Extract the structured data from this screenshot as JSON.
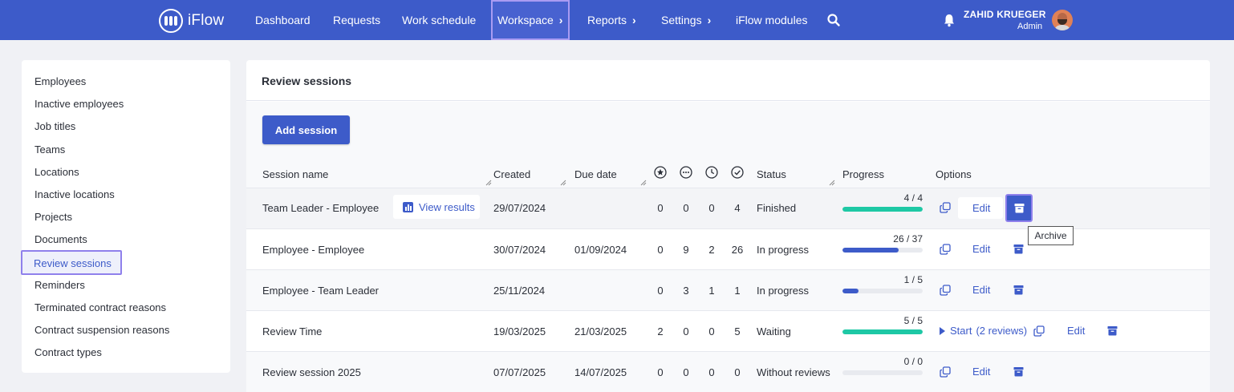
{
  "app": {
    "logo_text": "iFlow"
  },
  "nav": {
    "items": [
      {
        "label": "Dashboard",
        "chevron": false
      },
      {
        "label": "Requests",
        "chevron": false
      },
      {
        "label": "Work schedule",
        "chevron": false
      },
      {
        "label": "Workspace",
        "chevron": true,
        "active": true
      },
      {
        "label": "Reports",
        "chevron": true
      },
      {
        "label": "Settings",
        "chevron": true
      },
      {
        "label": "iFlow modules",
        "chevron": false
      }
    ],
    "chevron_glyph": "›",
    "search_icon": "search-icon"
  },
  "user": {
    "name": "ZAHID KRUEGER",
    "role": "Admin"
  },
  "sidebar": {
    "items": [
      {
        "label": "Employees"
      },
      {
        "label": "Inactive employees"
      },
      {
        "label": "Job titles"
      },
      {
        "label": "Teams"
      },
      {
        "label": "Locations"
      },
      {
        "label": "Inactive locations"
      },
      {
        "label": "Projects"
      },
      {
        "label": "Documents"
      },
      {
        "label": "Review sessions",
        "active": true
      },
      {
        "label": "Reminders"
      },
      {
        "label": "Terminated contract reasons"
      },
      {
        "label": "Contract suspension reasons"
      },
      {
        "label": "Contract types"
      }
    ]
  },
  "main": {
    "title": "Review sessions",
    "add_button": "Add session",
    "columns": {
      "name": "Session name",
      "created": "Created",
      "due": "Due date",
      "status": "Status",
      "progress": "Progress",
      "options": "Options"
    },
    "count_icons": [
      "star-icon",
      "more-icon",
      "clock-icon",
      "check-circle-icon"
    ],
    "view_results": "View results",
    "edit_label": "Edit",
    "rows": [
      {
        "name": "Team Leader - Employee",
        "created": "29/07/2024",
        "due": "",
        "c1": "0",
        "c2": "0",
        "c3": "0",
        "c4": "4",
        "status": "Finished",
        "progress_label": "4 / 4",
        "progress": 1.0,
        "color": "#1ec8a5"
      },
      {
        "name": "Employee - Employee",
        "created": "30/07/2024",
        "due": "01/09/2024",
        "c1": "0",
        "c2": "9",
        "c3": "2",
        "c4": "26",
        "status": "In progress",
        "progress_label": "26 / 37",
        "progress": 0.703,
        "color": "#3d5bc9"
      },
      {
        "name": "Employee - Team Leader",
        "created": "25/11/2024",
        "due": "",
        "c1": "0",
        "c2": "3",
        "c3": "1",
        "c4": "1",
        "status": "In progress",
        "progress_label": "1 / 5",
        "progress": 0.2,
        "color": "#3d5bc9"
      },
      {
        "name": "Review Time",
        "created": "19/03/2025",
        "due": "21/03/2025",
        "c1": "2",
        "c2": "0",
        "c3": "0",
        "c4": "5",
        "status": "Waiting",
        "progress_label": "5 / 5",
        "progress": 1.0,
        "color": "#1ec8a5",
        "start_label": "Start",
        "start_count": "(2 reviews)"
      },
      {
        "name": "Review session 2025",
        "created": "07/07/2025",
        "due": "14/07/2025",
        "c1": "0",
        "c2": "0",
        "c3": "0",
        "c4": "0",
        "status": "Without reviews",
        "progress_label": "0 / 0",
        "progress": 0.0,
        "color": "#3d5bc9"
      }
    ],
    "tooltip": "Archive"
  }
}
